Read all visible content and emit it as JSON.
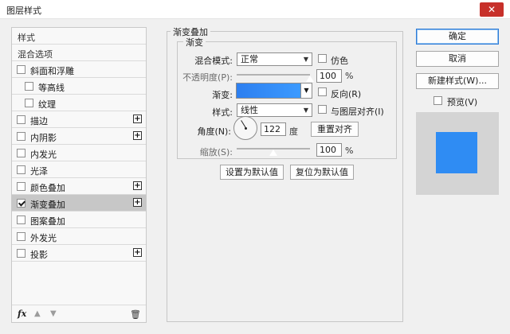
{
  "window": {
    "title": "图层样式",
    "close_label": "✕"
  },
  "styles_panel": {
    "header": "样式",
    "blend_options": "混合选项",
    "items": [
      {
        "label": "斜面和浮雕",
        "checked": false,
        "plus": false,
        "indent": false
      },
      {
        "label": "等高线",
        "checked": false,
        "plus": false,
        "indent": true
      },
      {
        "label": "纹理",
        "checked": false,
        "plus": false,
        "indent": true
      },
      {
        "label": "描边",
        "checked": false,
        "plus": true,
        "indent": false
      },
      {
        "label": "内阴影",
        "checked": false,
        "plus": true,
        "indent": false
      },
      {
        "label": "内发光",
        "checked": false,
        "plus": false,
        "indent": false
      },
      {
        "label": "光泽",
        "checked": false,
        "plus": false,
        "indent": false
      },
      {
        "label": "颜色叠加",
        "checked": false,
        "plus": true,
        "indent": false
      },
      {
        "label": "渐变叠加",
        "checked": true,
        "plus": true,
        "indent": false,
        "selected": true
      },
      {
        "label": "图案叠加",
        "checked": false,
        "plus": false,
        "indent": false
      },
      {
        "label": "外发光",
        "checked": false,
        "plus": false,
        "indent": false
      },
      {
        "label": "投影",
        "checked": false,
        "plus": true,
        "indent": false
      }
    ],
    "fx_label": "fx"
  },
  "gradient_overlay": {
    "section_title": "渐变叠加",
    "group_title": "渐变",
    "blend_mode_label": "混合模式:",
    "blend_mode_value": "正常",
    "dither_label": "仿色",
    "dither_checked": false,
    "opacity_label": "不透明度(P):",
    "opacity_value": "100",
    "opacity_unit": "%",
    "opacity_level": 1.0,
    "gradient_label": "渐变:",
    "gradient_colors": [
      "#2d7ff0",
      "#3b9aff"
    ],
    "reverse_label": "反向(R)",
    "reverse_checked": true,
    "style_label": "样式:",
    "style_value": "线性",
    "align_label": "与图层对齐(I)",
    "align_checked": true,
    "angle_label": "角度(N):",
    "angle_value": "122",
    "angle_unit": "度",
    "reset_alignment_label": "重置对齐",
    "scale_label": "缩放(S):",
    "scale_value": "100",
    "scale_unit": "%",
    "scale_level": 0.5,
    "make_default_label": "设置为默认值",
    "reset_default_label": "复位为默认值"
  },
  "actions": {
    "ok_label": "确定",
    "cancel_label": "取消",
    "new_style_label": "新建样式(W)...",
    "preview_label": "预览(V)",
    "preview_checked": true,
    "preview_color": "#2f8cf3"
  }
}
